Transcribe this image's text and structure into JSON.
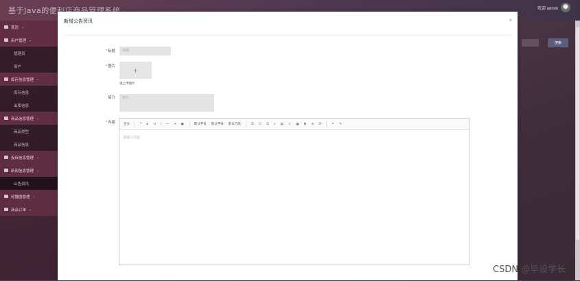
{
  "app": {
    "title": "基于Java的便利店商品管理系统",
    "user": "欢迎 admin"
  },
  "sidebar": {
    "items": [
      {
        "label": "首页",
        "type": "group"
      },
      {
        "label": "用户管理",
        "type": "group"
      },
      {
        "label": "管理员",
        "type": "sub"
      },
      {
        "label": "用户",
        "type": "sub"
      },
      {
        "label": "库存信息管理",
        "type": "group"
      },
      {
        "label": "库存信息",
        "type": "sub"
      },
      {
        "label": "出库信息",
        "type": "sub"
      },
      {
        "label": "商品信息管理",
        "type": "group"
      },
      {
        "label": "商品类型",
        "type": "sub"
      },
      {
        "label": "商品信息",
        "type": "sub"
      },
      {
        "label": "投诉信息管理",
        "type": "group"
      },
      {
        "label": "新闻信息管理",
        "type": "group"
      },
      {
        "label": "公告资讯",
        "type": "sub-active"
      },
      {
        "label": "轮播图管理",
        "type": "group"
      },
      {
        "label": "商品订单",
        "type": "group"
      }
    ]
  },
  "background": {
    "search_button": "搜索"
  },
  "modal": {
    "title": "新增公告资讯",
    "close": "×",
    "fields": {
      "title_label": "标题",
      "title_placeholder": "标题",
      "image_label": "图片",
      "upload_plus": "+",
      "upload_tip": "请上传图片",
      "intro_label": "简介",
      "intro_placeholder": "简介",
      "content_label": "内容",
      "content_placeholder": "请输入内容"
    },
    "toolbar": [
      "正文",
      "❝",
      "B",
      "U",
      "I",
      "—",
      "A",
      "▣",
      "默认字号",
      "默认字体",
      "默认行高",
      "☰",
      "☷",
      "☑",
      "≡",
      "▤",
      "☺",
      "▦",
      "⊞",
      "⊘",
      "☰",
      "↶",
      "↷"
    ]
  },
  "watermark": "CSDN @毕设学长"
}
